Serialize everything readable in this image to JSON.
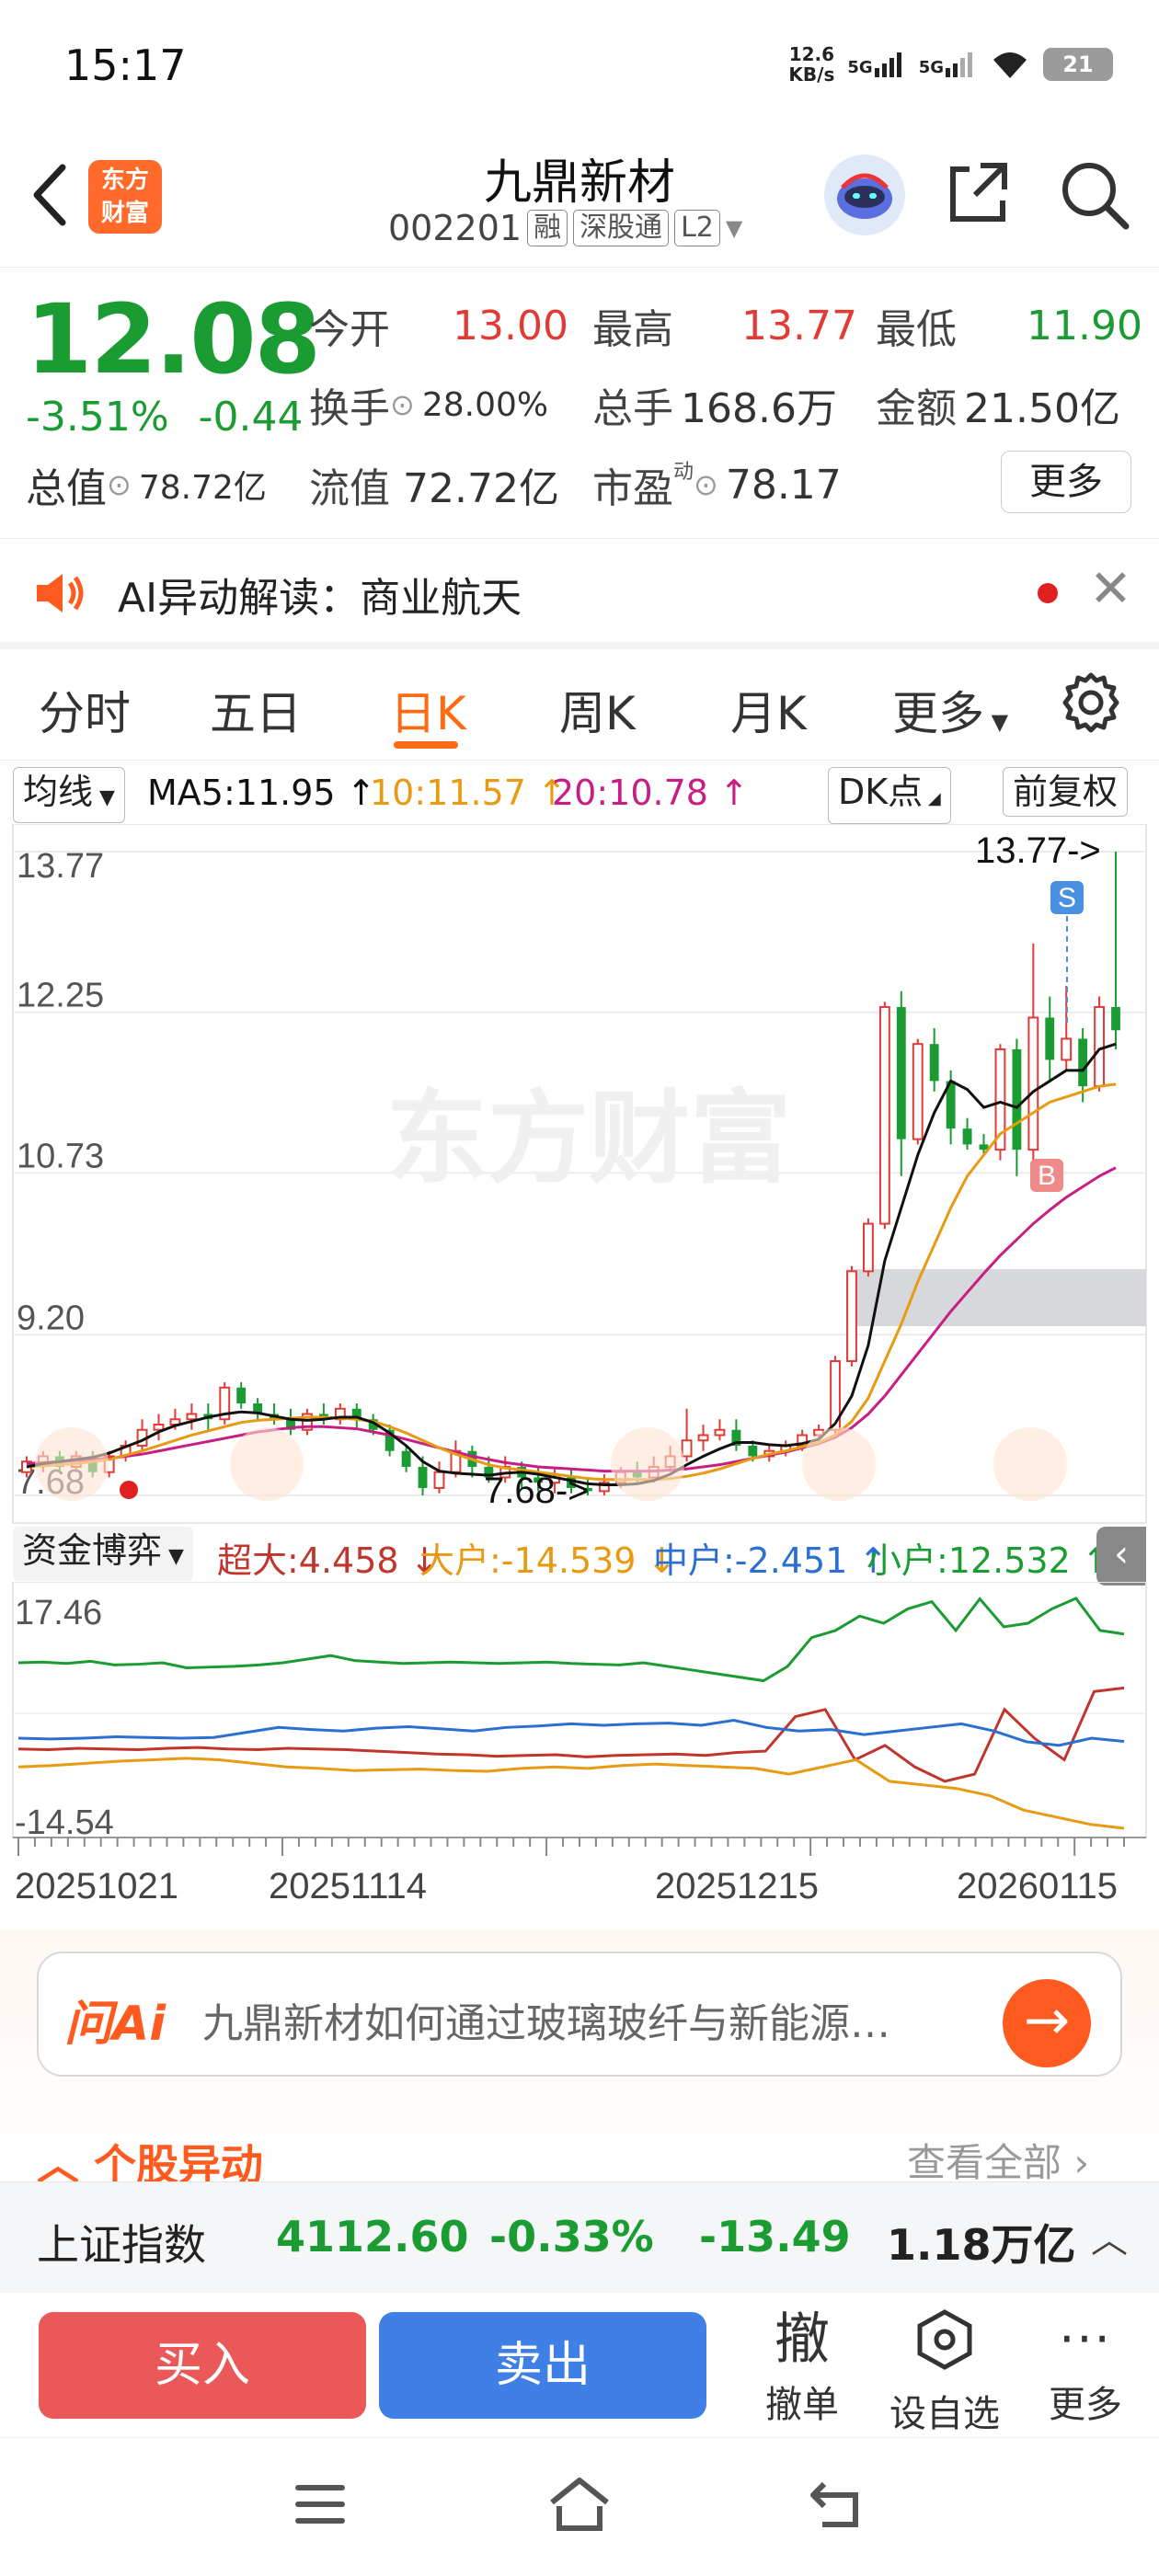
{
  "status_bar": {
    "time": "15:17",
    "net_speed_top": "12.6",
    "net_speed_bottom": "KB/s",
    "sig1": "5G",
    "sig2": "5G",
    "battery": "21"
  },
  "header": {
    "logo_line1": "东方",
    "logo_line2": "财富",
    "title": "九鼎新材",
    "code": "002201",
    "tags": [
      "融",
      "深股通",
      "L2"
    ]
  },
  "quote": {
    "price": "12.08",
    "pct": "-3.51%",
    "chg": "-0.44",
    "open_label": "今开",
    "open": "13.00",
    "high_label": "最高",
    "high": "13.77",
    "low_label": "最低",
    "low": "11.90",
    "turnover_label": "换手",
    "turnover": "28.00%",
    "volume_label": "总手",
    "volume": "168.6万",
    "amount_label": "金额",
    "amount": "21.50亿",
    "mcap_label": "总值",
    "mcap": "78.72亿",
    "float_label": "流值",
    "float": "72.72亿",
    "pe_label": "市盈",
    "pe_sup": "动",
    "pe": "78.17",
    "more": "更多"
  },
  "ai_bar": {
    "text": "AI异动解读：商业航天"
  },
  "tabs": [
    "分时",
    "五日",
    "日K",
    "周K",
    "月K",
    "更多"
  ],
  "active_tab": 2,
  "ma_header": {
    "selector": "均线",
    "ma5": "MA5:11.95 ↑",
    "ma10": "10:11.57 ↑",
    "ma20": "20:10.78 ↑",
    "dk": "DK点",
    "adj": "前复权"
  },
  "colors": {
    "up": "#e23b35",
    "down": "#1a9c32",
    "ma5": "#111111",
    "ma10": "#e79a12",
    "ma20": "#c81e83",
    "accent": "#ff6a13"
  },
  "chart_data": [
    {
      "type": "candlestick",
      "y_ticks": [
        "13.77",
        "12.25",
        "10.73",
        "9.20",
        "7.68"
      ],
      "ylim": [
        7.68,
        13.77
      ],
      "annotations": {
        "high": "13.77->",
        "low": "7.68->",
        "watermark": "东方财富",
        "marker_b": "B",
        "marker_s": "S"
      },
      "candles": [
        [
          7.9,
          8.0,
          7.85,
          8.05
        ],
        [
          7.98,
          8.05,
          7.9,
          8.1
        ],
        [
          8.05,
          7.95,
          7.9,
          8.1
        ],
        [
          7.95,
          8.05,
          7.9,
          8.1
        ],
        [
          8.05,
          7.9,
          7.85,
          8.1
        ],
        [
          7.9,
          8.05,
          7.85,
          8.1
        ],
        [
          8.05,
          8.15,
          8.0,
          8.2
        ],
        [
          8.15,
          8.3,
          8.1,
          8.4
        ],
        [
          8.3,
          8.35,
          8.2,
          8.45
        ],
        [
          8.35,
          8.4,
          8.3,
          8.5
        ],
        [
          8.4,
          8.45,
          8.3,
          8.55
        ],
        [
          8.45,
          8.4,
          8.3,
          8.55
        ],
        [
          8.4,
          8.7,
          8.35,
          8.75
        ],
        [
          8.7,
          8.55,
          8.5,
          8.75
        ],
        [
          8.55,
          8.45,
          8.4,
          8.6
        ],
        [
          8.45,
          8.4,
          8.35,
          8.55
        ],
        [
          8.4,
          8.3,
          8.25,
          8.5
        ],
        [
          8.3,
          8.45,
          8.25,
          8.5
        ],
        [
          8.45,
          8.4,
          8.35,
          8.55
        ],
        [
          8.4,
          8.5,
          8.35,
          8.55
        ],
        [
          8.5,
          8.4,
          8.3,
          8.55
        ],
        [
          8.4,
          8.3,
          8.25,
          8.45
        ],
        [
          8.3,
          8.1,
          8.05,
          8.35
        ],
        [
          8.1,
          7.95,
          7.9,
          8.15
        ],
        [
          7.95,
          7.75,
          7.68,
          8.05
        ],
        [
          7.75,
          7.9,
          7.7,
          8.0
        ],
        [
          7.9,
          8.1,
          7.85,
          8.2
        ],
        [
          8.1,
          7.95,
          7.85,
          8.15
        ],
        [
          7.95,
          7.85,
          7.8,
          8.05
        ],
        [
          7.85,
          7.95,
          7.8,
          8.05
        ],
        [
          7.95,
          7.85,
          7.75,
          8.0
        ],
        [
          7.85,
          7.8,
          7.72,
          7.95
        ],
        [
          7.8,
          7.85,
          7.7,
          7.95
        ],
        [
          7.85,
          7.75,
          7.7,
          7.92
        ],
        [
          7.75,
          7.72,
          7.68,
          7.85
        ],
        [
          7.72,
          7.8,
          7.68,
          7.88
        ],
        [
          7.8,
          7.9,
          7.75,
          7.95
        ],
        [
          7.9,
          7.85,
          7.8,
          8.0
        ],
        [
          7.85,
          7.95,
          7.8,
          8.05
        ],
        [
          7.95,
          8.05,
          7.9,
          8.15
        ],
        [
          8.05,
          8.2,
          8.0,
          8.5
        ],
        [
          8.2,
          8.25,
          8.1,
          8.35
        ],
        [
          8.25,
          8.3,
          8.2,
          8.4
        ],
        [
          8.3,
          8.15,
          8.1,
          8.4
        ],
        [
          8.15,
          8.05,
          8.0,
          8.2
        ],
        [
          8.05,
          8.1,
          8.0,
          8.15
        ],
        [
          8.1,
          8.15,
          8.05,
          8.2
        ],
        [
          8.15,
          8.25,
          8.1,
          8.3
        ],
        [
          8.25,
          8.3,
          8.2,
          8.35
        ],
        [
          8.3,
          8.95,
          8.25,
          9.0
        ],
        [
          8.95,
          9.8,
          8.9,
          9.85
        ],
        [
          9.8,
          10.25,
          9.75,
          10.3
        ],
        [
          10.25,
          12.3,
          10.2,
          12.35
        ],
        [
          12.3,
          11.05,
          10.7,
          12.45
        ],
        [
          11.05,
          11.95,
          11.0,
          12.0
        ],
        [
          11.95,
          11.6,
          11.5,
          12.1
        ],
        [
          11.6,
          11.15,
          11.0,
          11.7
        ],
        [
          11.15,
          11.0,
          10.95,
          11.25
        ],
        [
          11.0,
          10.95,
          10.9,
          11.1
        ],
        [
          10.95,
          11.9,
          10.85,
          11.95
        ],
        [
          11.9,
          10.95,
          10.7,
          12.0
        ],
        [
          10.95,
          12.2,
          10.8,
          12.9
        ],
        [
          12.2,
          11.8,
          11.6,
          12.4
        ],
        [
          11.8,
          12.0,
          11.7,
          12.5
        ],
        [
          12.0,
          11.55,
          11.4,
          12.1
        ],
        [
          11.55,
          12.3,
          11.5,
          12.4
        ],
        [
          12.3,
          12.08,
          11.9,
          13.77
        ]
      ],
      "ma5": [
        7.95,
        7.98,
        8.0,
        8.02,
        8.04,
        8.08,
        8.14,
        8.2,
        8.28,
        8.34,
        8.38,
        8.42,
        8.45,
        8.47,
        8.46,
        8.43,
        8.4,
        8.39,
        8.4,
        8.42,
        8.42,
        8.37,
        8.27,
        8.15,
        8.0,
        7.91,
        7.89,
        7.88,
        7.87,
        7.89,
        7.9,
        7.88,
        7.85,
        7.82,
        7.79,
        7.78,
        7.78,
        7.79,
        7.82,
        7.88,
        7.97,
        8.05,
        8.12,
        8.18,
        8.18,
        8.16,
        8.15,
        8.17,
        8.21,
        8.36,
        8.62,
        9.1,
        9.9,
        10.4,
        10.9,
        11.3,
        11.6,
        11.52,
        11.35,
        11.4,
        11.35,
        11.5,
        11.6,
        11.7,
        11.7,
        11.9,
        11.95
      ],
      "ma10": [
        7.95,
        7.96,
        7.97,
        7.98,
        8.0,
        8.02,
        8.06,
        8.1,
        8.15,
        8.2,
        8.25,
        8.29,
        8.33,
        8.37,
        8.39,
        8.4,
        8.41,
        8.42,
        8.42,
        8.41,
        8.4,
        8.38,
        8.33,
        8.27,
        8.2,
        8.13,
        8.07,
        8.02,
        7.97,
        7.94,
        7.92,
        7.9,
        7.88,
        7.86,
        7.84,
        7.83,
        7.83,
        7.83,
        7.83,
        7.84,
        7.86,
        7.89,
        7.93,
        7.98,
        8.03,
        8.07,
        8.1,
        8.14,
        8.18,
        8.25,
        8.38,
        8.6,
        8.95,
        9.3,
        9.7,
        10.05,
        10.4,
        10.7,
        10.9,
        11.1,
        11.2,
        11.3,
        11.4,
        11.45,
        11.5,
        11.55,
        11.57
      ],
      "ma20": [
        7.98,
        7.99,
        8.0,
        8.01,
        8.02,
        8.03,
        8.05,
        8.07,
        8.1,
        8.13,
        8.16,
        8.19,
        8.22,
        8.25,
        8.28,
        8.3,
        8.32,
        8.33,
        8.33,
        8.32,
        8.31,
        8.28,
        8.25,
        8.21,
        8.17,
        8.13,
        8.09,
        8.05,
        8.02,
        7.99,
        7.97,
        7.95,
        7.94,
        7.93,
        7.92,
        7.91,
        7.91,
        7.91,
        7.91,
        7.92,
        7.93,
        7.95,
        7.97,
        8.0,
        8.03,
        8.06,
        8.09,
        8.13,
        8.17,
        8.23,
        8.32,
        8.45,
        8.62,
        8.82,
        9.02,
        9.22,
        9.42,
        9.6,
        9.78,
        9.95,
        10.1,
        10.25,
        10.38,
        10.5,
        10.6,
        10.7,
        10.78
      ]
    },
    {
      "type": "line",
      "title": "资金博弈",
      "y_ticks": [
        "17.46",
        "-14.54"
      ],
      "ylim": [
        -14.54,
        17.46
      ],
      "x_ticks": [
        "20251021",
        "20251114",
        "20251215",
        "20260115"
      ],
      "legend": [
        {
          "label": "超大:4.458 ↓",
          "color": "#c0362c"
        },
        {
          "label": "大户:-14.539 ↓",
          "color": "#e79a12"
        },
        {
          "label": "中户:-2.451 ↑",
          "color": "#2b6fd1"
        },
        {
          "label": "小户:12.532 ↑",
          "color": "#1a9c32"
        }
      ],
      "series": [
        {
          "name": "小户",
          "values": [
            8.5,
            8.6,
            8.4,
            8.7,
            8.2,
            8.3,
            8.5,
            7.8,
            7.9,
            8.0,
            8.2,
            8.5,
            9.0,
            9.5,
            8.8,
            8.6,
            8.4,
            8.5,
            8.6,
            8.5,
            8.4,
            8.5,
            8.6,
            8.4,
            8.3,
            8.2,
            8.5,
            8.0,
            7.5,
            7.0,
            6.5,
            6.0,
            8.0,
            12.0,
            13.0,
            15.0,
            14.0,
            16.0,
            17.0,
            13.0,
            17.4,
            13.5,
            14.0,
            16.0,
            17.46,
            13.0,
            12.5
          ]
        },
        {
          "name": "超大",
          "values": [
            -3.5,
            -3.6,
            -3.4,
            -3.5,
            -3.6,
            -3.4,
            -3.3,
            -3.5,
            -3.6,
            -3.4,
            -3.5,
            -3.6,
            -3.8,
            -4.0,
            -4.2,
            -4.3,
            -4.5,
            -4.4,
            -4.3,
            -4.6,
            -4.4,
            -4.3,
            -4.2,
            -4.4,
            -4.0,
            -3.8,
            1.0,
            2.0,
            -5.0,
            -3.0,
            -6.0,
            -8.0,
            -7.0,
            2.0,
            -2.0,
            -5.0,
            4.5,
            5.0
          ]
        },
        {
          "name": "中户",
          "values": [
            -2.0,
            -2.1,
            -2.0,
            -1.8,
            -1.9,
            -2.0,
            -1.9,
            -1.2,
            -0.5,
            -0.8,
            -1.0,
            -0.6,
            -0.4,
            -0.7,
            -1.0,
            -0.5,
            -0.3,
            0.0,
            -0.2,
            0.0,
            0.1,
            -0.2,
            0.5,
            -0.5,
            -1.0,
            -0.8,
            -1.5,
            -1.0,
            -0.5,
            0.0,
            -1.0,
            -2.5,
            -3.0,
            -2.0,
            -2.451
          ]
        },
        {
          "name": "大户",
          "values": [
            -6.0,
            -5.8,
            -5.5,
            -5.2,
            -5.0,
            -4.8,
            -5.0,
            -5.5,
            -6.0,
            -6.2,
            -6.5,
            -6.4,
            -6.3,
            -6.5,
            -6.6,
            -6.2,
            -6.0,
            -6.2,
            -5.8,
            -5.6,
            -5.8,
            -6.0,
            -6.2,
            -7.0,
            -6.0,
            -5.0,
            -8.0,
            -8.5,
            -9.0,
            -10.0,
            -12.0,
            -13.0,
            -14.0,
            -14.539
          ]
        }
      ]
    }
  ],
  "ask_ai": {
    "logo": "问Ai",
    "text": "九鼎新材如何通过玻璃玻纤与新能源…"
  },
  "section": {
    "title": "个股异动",
    "view_all": "查看全部"
  },
  "index_bar": {
    "name": "上证指数",
    "value": "4112.60",
    "pct": "-0.33%",
    "chg": "-13.49",
    "amount": "1.18万亿"
  },
  "actions": {
    "buy": "买入",
    "sell": "卖出",
    "cancel_glyph": "撤",
    "cancel": "撤单",
    "watch": "设自选",
    "more": "更多"
  }
}
